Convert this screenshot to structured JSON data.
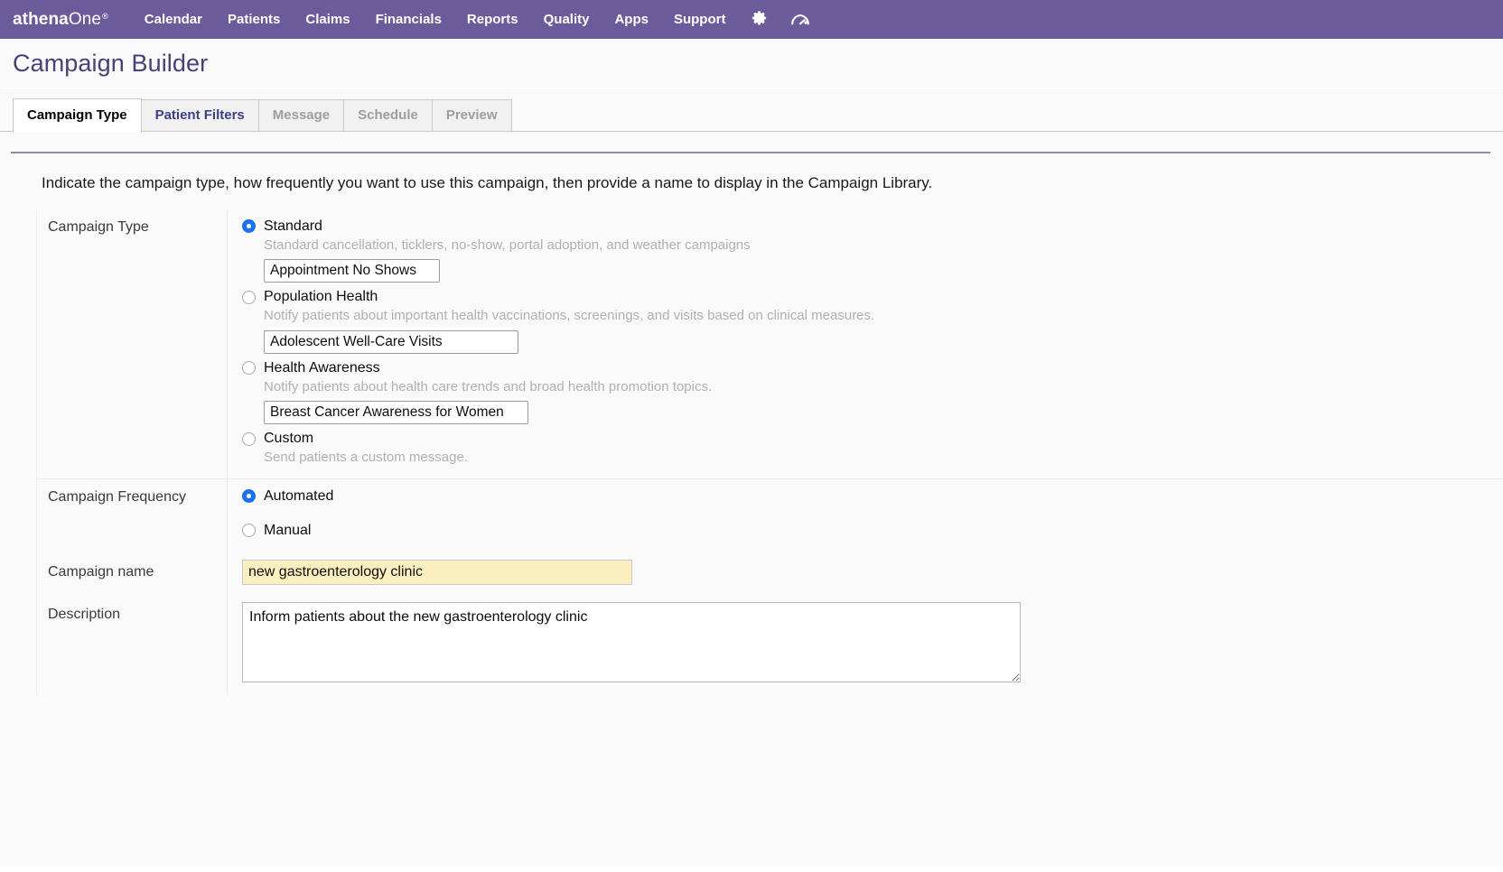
{
  "navbar": {
    "brand_bold": "athena",
    "brand_light": "One",
    "brand_reg": "®",
    "links": [
      {
        "label": "Calendar"
      },
      {
        "label": "Patients"
      },
      {
        "label": "Claims"
      },
      {
        "label": "Financials"
      },
      {
        "label": "Reports"
      },
      {
        "label": "Quality"
      },
      {
        "label": "Apps"
      },
      {
        "label": "Support"
      }
    ],
    "icons": [
      {
        "name": "gear-icon"
      },
      {
        "name": "gauge-icon"
      }
    ],
    "background_color": "#6b5b9a"
  },
  "header": {
    "title": "Campaign Builder",
    "title_color": "#4b3f7a"
  },
  "tabs": [
    {
      "label": "Campaign Type",
      "state": "active"
    },
    {
      "label": "Patient Filters",
      "state": "enabled"
    },
    {
      "label": "Message",
      "state": "disabled"
    },
    {
      "label": "Schedule",
      "state": "disabled"
    },
    {
      "label": "Preview",
      "state": "disabled"
    }
  ],
  "main": {
    "instructions": "Indicate the campaign type, how frequently you want to use this campaign, then provide a name to display in the Campaign Library.",
    "campaign_type": {
      "label": "Campaign Type",
      "options": [
        {
          "label": "Standard",
          "description": "Standard cancellation, ticklers, no-show, portal adoption, and weather campaigns",
          "selected": true,
          "dropdown_value": "Appointment No Shows"
        },
        {
          "label": "Population Health",
          "description": "Notify patients about important health vaccinations, screenings, and visits based on clinical measures.",
          "selected": false,
          "dropdown_value": "Adolescent Well-Care Visits"
        },
        {
          "label": "Health Awareness",
          "description": "Notify patients about health care trends and broad health promotion topics.",
          "selected": false,
          "dropdown_value": "Breast Cancer Awareness for Women"
        },
        {
          "label": "Custom",
          "description": "Send patients a custom message.",
          "selected": false
        }
      ]
    },
    "campaign_frequency": {
      "label": "Campaign Frequency",
      "options": [
        {
          "label": "Automated",
          "selected": true
        },
        {
          "label": "Manual",
          "selected": false
        }
      ]
    },
    "campaign_name": {
      "label": "Campaign name",
      "value": "new gastroenterology clinic",
      "placeholder": "",
      "highlight_color": "#fcefbf"
    },
    "description": {
      "label": "Description",
      "value": "Inform patients about the new gastroenterology clinic",
      "placeholder": ""
    }
  }
}
